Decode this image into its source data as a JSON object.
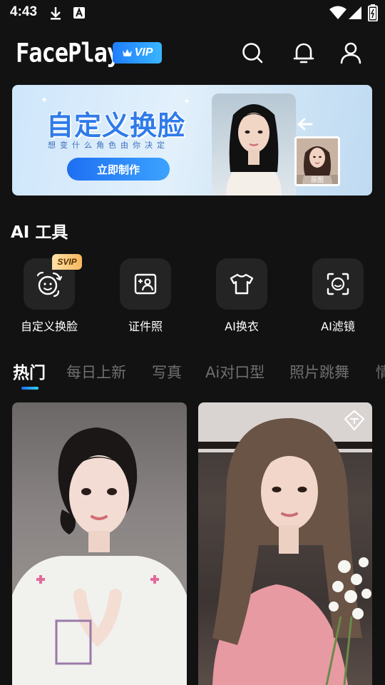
{
  "status_bar": {
    "time": "4:43"
  },
  "header": {
    "logo": "FacePlay",
    "vip_label": "VIP"
  },
  "banner": {
    "title": "自定义换脸",
    "subtitle": "想变什么角色由你决定",
    "button_label": "立即制作",
    "original_label": "原图"
  },
  "tools": {
    "section_title": "AI 工具",
    "items": [
      {
        "label": "自定义换脸",
        "badge": "SVIP",
        "icon": "face-swap-icon"
      },
      {
        "label": "证件照",
        "icon": "id-photo-icon"
      },
      {
        "label": "AI换衣",
        "icon": "tshirt-icon"
      },
      {
        "label": "AI滤镜",
        "icon": "face-scan-icon"
      }
    ]
  },
  "tabs": [
    "热门",
    "每日上新",
    "写真",
    "Ai对口型",
    "照片跳舞",
    "情"
  ],
  "active_tab": 0,
  "colors": {
    "accent": "#2a8cff",
    "background": "#121212",
    "tile": "#242424",
    "tab_inactive": "#6f6f6f"
  }
}
